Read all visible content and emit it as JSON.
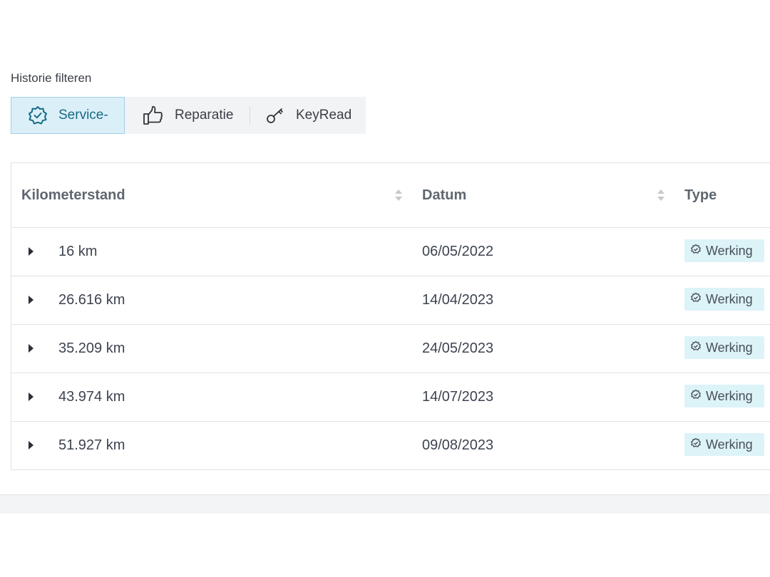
{
  "filter": {
    "label": "Historie filteren",
    "options": [
      {
        "label": "Service-",
        "icon": "badge-check-icon",
        "active": true
      },
      {
        "label": "Reparatie",
        "icon": "thumbs-up-icon",
        "active": false
      },
      {
        "label": "KeyRead",
        "icon": "key-icon",
        "active": false
      }
    ]
  },
  "table": {
    "columns": [
      "Kilometerstand",
      "Datum",
      "Type"
    ],
    "rows": [
      {
        "km": "16 km",
        "date": "06/05/2022",
        "type": "Werking"
      },
      {
        "km": "26.616 km",
        "date": "14/04/2023",
        "type": "Werking"
      },
      {
        "km": "35.209 km",
        "date": "24/05/2023",
        "type": "Werking"
      },
      {
        "km": "43.974 km",
        "date": "14/07/2023",
        "type": "Werking"
      },
      {
        "km": "51.927 km",
        "date": "09/08/2023",
        "type": "Werking"
      }
    ]
  },
  "colors": {
    "accent": "#176b86",
    "active_bg": "#dbeff8",
    "badge_bg": "#dcf3f8"
  }
}
